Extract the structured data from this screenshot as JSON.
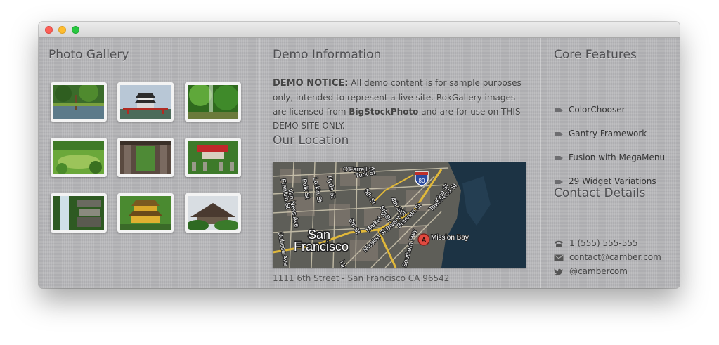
{
  "gallery": {
    "title": "Photo Gallery",
    "thumbs": [
      {
        "name": "garden pond"
      },
      {
        "name": "castle"
      },
      {
        "name": "forest path"
      },
      {
        "name": "green garden"
      },
      {
        "name": "temple gate"
      },
      {
        "name": "red shrine"
      },
      {
        "name": "waterfall"
      },
      {
        "name": "golden pavilion"
      },
      {
        "name": "pine temple"
      }
    ]
  },
  "demo": {
    "title": "Demo Information",
    "notice_label": "DEMO NOTICE:",
    "notice_text_1": "All demo content is for sample purposes only, intended to represent a live site. RokGallery images are licensed from",
    "notice_link": "BigStockPhoto",
    "notice_text_2": "and are for use on THIS DEMO SITE ONLY."
  },
  "location": {
    "title": "Our Location",
    "map_labels": {
      "city_line1": "San",
      "city_line2": "Francisco",
      "marker_letter": "A",
      "mission_bay": "Mission Bay",
      "freeway": "80",
      "streets": [
        "O'Farrell St",
        "Van Ness Ave",
        "Hyde St",
        "Turk St",
        "Franklin St",
        "Polk St",
        "Larkin St",
        "6th St",
        "8th St",
        "5th St",
        "4th St",
        "Bryant St",
        "Brannan St",
        "Townsend St",
        "King St",
        "Market St",
        "Southern Fwy",
        "Duboce Ave",
        "Valencia St",
        "Mission St"
      ]
    },
    "address": "1111 6th Street - San Francisco CA 96542"
  },
  "features": {
    "title": "Core Features",
    "items": [
      "ColorChooser",
      "Gantry Framework",
      "Fusion with MegaMenu",
      "29 Widget Variations"
    ]
  },
  "contact": {
    "title": "Contact Details",
    "phone": "1 (555) 555-555",
    "email": "contact@camber.com",
    "twitter": "@cambercom"
  }
}
